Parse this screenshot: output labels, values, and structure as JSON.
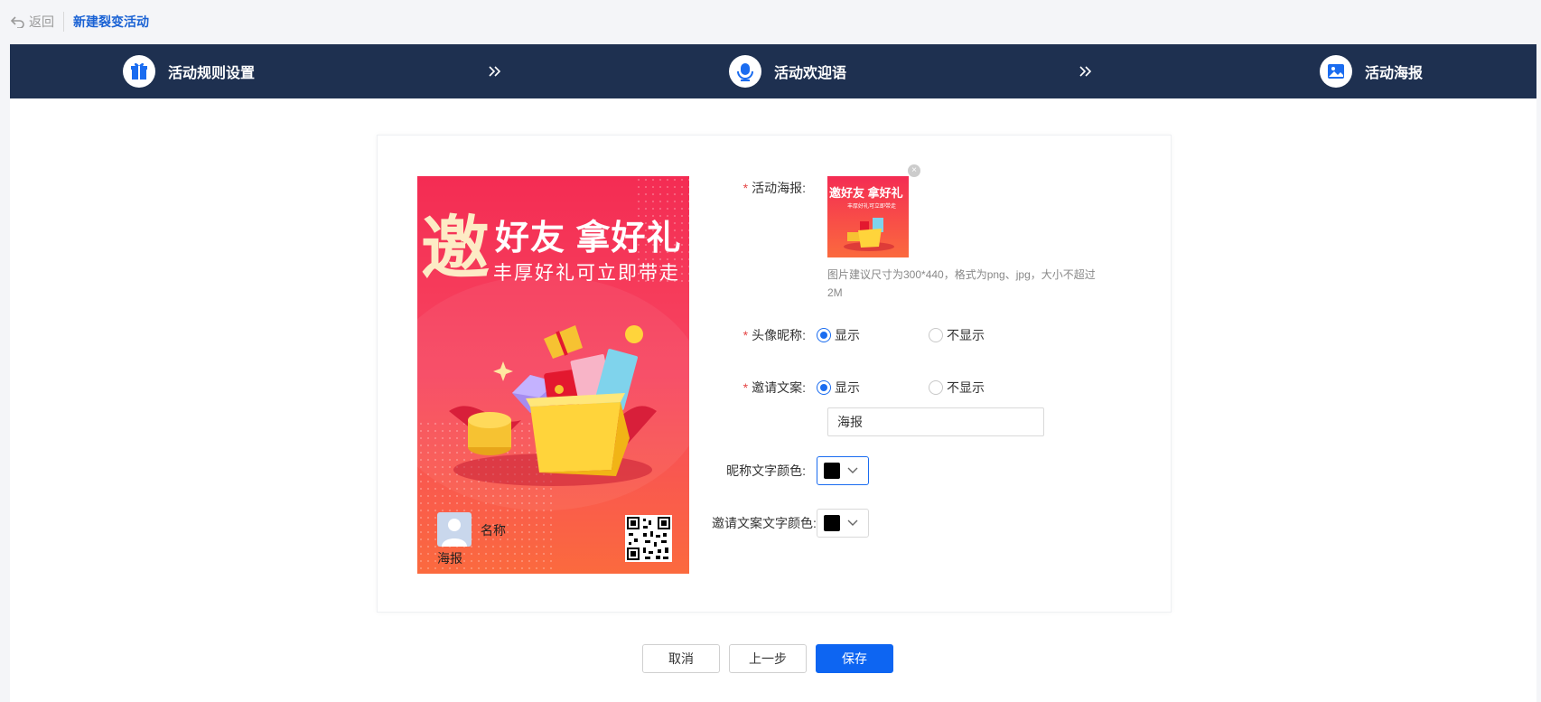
{
  "header": {
    "back_label": "返回",
    "title": "新建裂变活动"
  },
  "steps": [
    {
      "label": "活动规则设置",
      "icon": "gift-icon"
    },
    {
      "label": "活动欢迎语",
      "icon": "microphone-icon"
    },
    {
      "label": "活动海报",
      "icon": "image-icon"
    }
  ],
  "poster": {
    "big_char": "邀",
    "line1": "好友 拿好礼",
    "line2": "丰厚好礼可立即带走",
    "nickname": "名称",
    "invite_text": "海报"
  },
  "form": {
    "poster_label": "活动海报:",
    "poster_hint": "图片建议尺寸为300*440，格式为png、jpg，大小不超过2M",
    "thumb_title": "邀好友 拿好礼",
    "thumb_sub": "丰厚好礼可立即带走",
    "avatar_label": "头像昵称:",
    "invite_label": "邀请文案:",
    "show_label": "显示",
    "hide_label": "不显示",
    "invite_input_value": "海报",
    "nick_color_label": "昵称文字颜色:",
    "invite_color_label": "邀请文案文字颜色:",
    "nick_color": "#000000",
    "invite_color": "#000000"
  },
  "actions": {
    "cancel": "取消",
    "prev": "上一步",
    "save": "保存"
  },
  "colors": {
    "primary": "#0d65f2",
    "header_bg": "#1e3050",
    "accent_link": "#1a62d4"
  }
}
